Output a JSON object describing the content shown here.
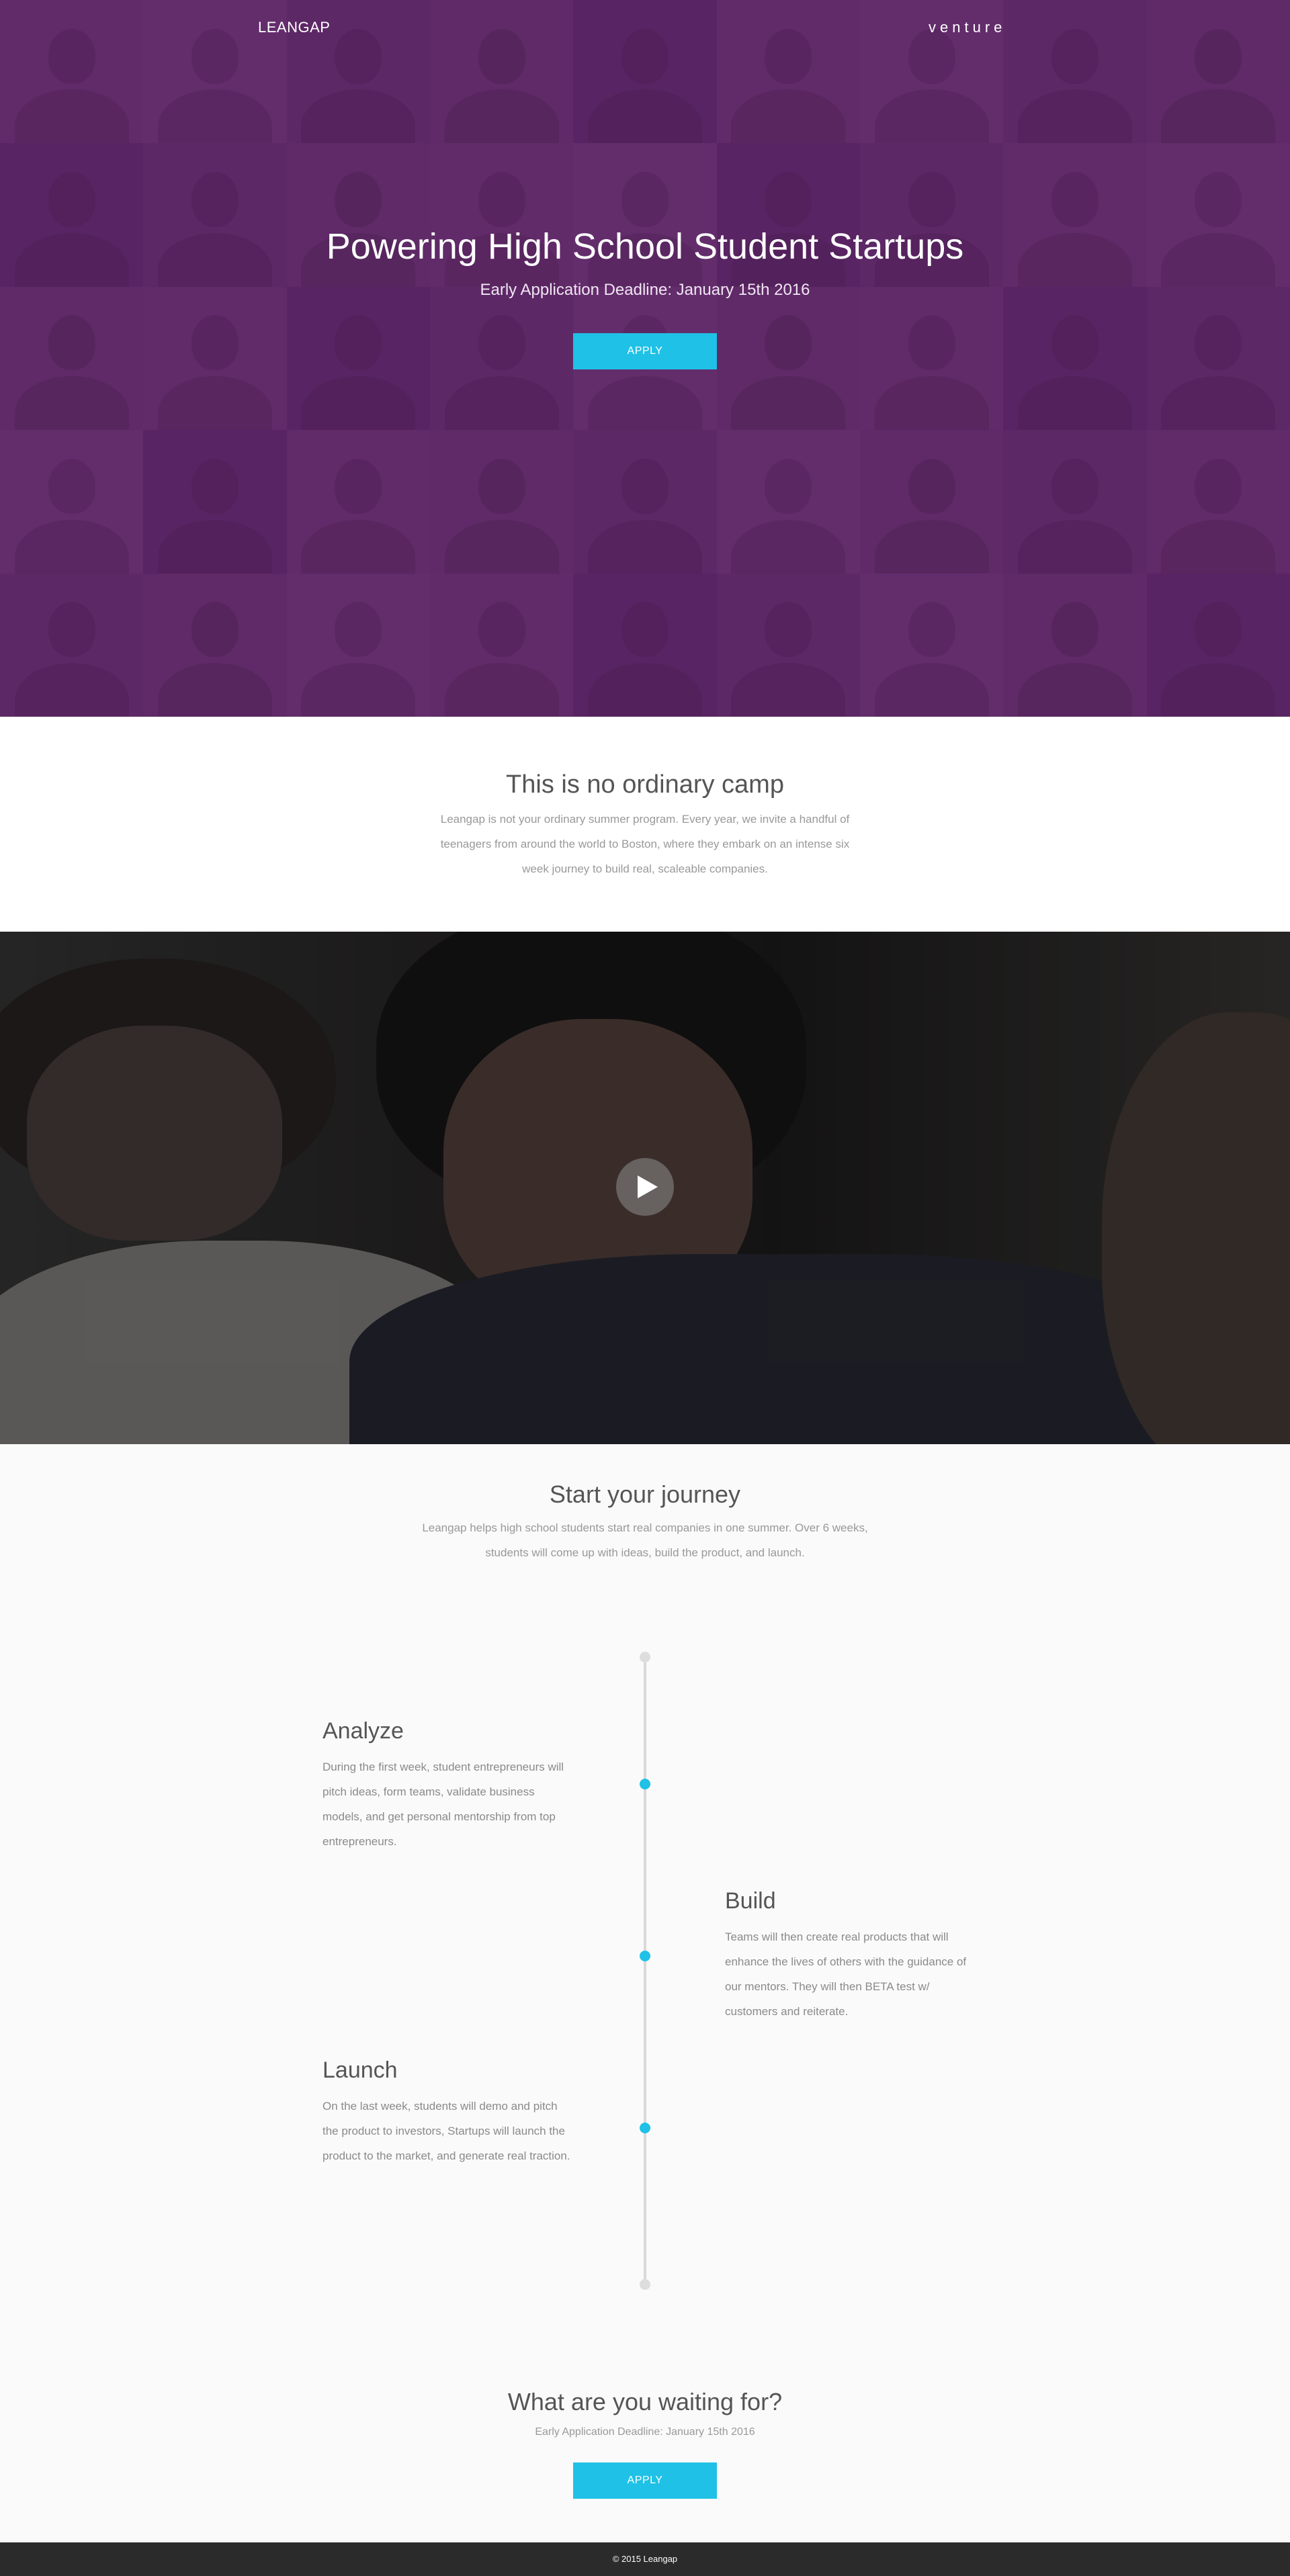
{
  "header": {
    "brand": "LEANGAP",
    "nav_link": "venture"
  },
  "hero": {
    "title": "Powering High School Student Startups",
    "subtitle": "Early Application Deadline: January 15th 2016",
    "apply_label": "APPLY"
  },
  "intro": {
    "title": "This is no ordinary camp",
    "text": "Leangap is not your ordinary summer program. Every year, we invite a handful of teenagers from around the world to Boston, where they embark on an intense six week journey to build real, scaleable companies."
  },
  "video": {
    "play_icon": "play-icon"
  },
  "journey": {
    "title": "Start your journey",
    "text": "Leangap helps high school students start real companies in one summer. Over 6 weeks, students will come up with ideas, build the product, and launch.",
    "steps": [
      {
        "title": "Analyze",
        "text": "During the first week, student entrepreneurs will pitch ideas, form teams, validate business models, and get personal mentorship from top entrepreneurs."
      },
      {
        "title": "Build",
        "text": "Teams will then create real products that will enhance the lives of others with the guidance of our mentors. They will then BETA test w/ customers and reiterate."
      },
      {
        "title": "Launch",
        "text": "On the last week, students will demo and pitch the product to investors, Startups will launch the product to the market, and generate real traction."
      }
    ]
  },
  "cta": {
    "title": "What are you waiting for?",
    "subtitle": "Early Application Deadline: January 15th 2016",
    "apply_label": "APPLY"
  },
  "footer": {
    "text": "© 2015 Leangap"
  },
  "colors": {
    "accent": "#1fc1e6",
    "hero_overlay": "#5c2666",
    "footer_bg": "#2b2b2b"
  }
}
